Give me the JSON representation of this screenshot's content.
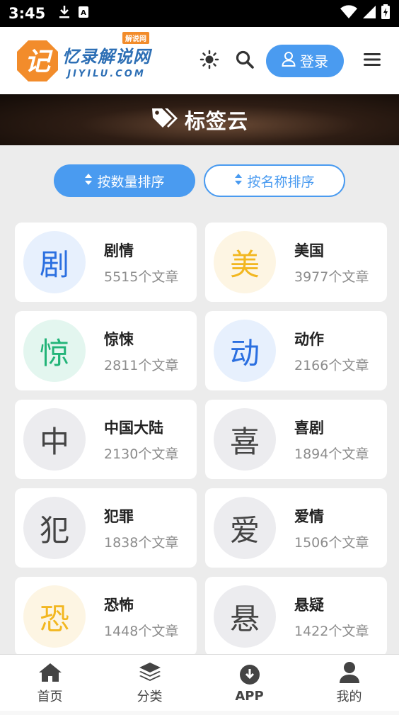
{
  "status_bar": {
    "time": "3:45",
    "icons": [
      "download-icon",
      "a-keyboard-icon",
      "wifi-icon",
      "signal-icon",
      "battery-icon"
    ]
  },
  "header": {
    "logo_mark": "记",
    "logo_cn": "忆录解说网",
    "logo_en": "JIYILU.COM",
    "logo_badge": "解说网",
    "login_label": "登录",
    "icons": [
      "sun-icon",
      "search-icon",
      "user-icon",
      "menu-icon"
    ]
  },
  "banner": {
    "title": "标签云",
    "icon": "tags-icon"
  },
  "sort": {
    "by_count": "按数量排序",
    "by_name": "按名称排序"
  },
  "tags": [
    {
      "char": "剧",
      "name": "剧情",
      "count": "5515个文章",
      "color": "blue"
    },
    {
      "char": "美",
      "name": "美国",
      "count": "3977个文章",
      "color": "yellow"
    },
    {
      "char": "惊",
      "name": "惊悚",
      "count": "2811个文章",
      "color": "green"
    },
    {
      "char": "动",
      "name": "动作",
      "count": "2166个文章",
      "color": "blue"
    },
    {
      "char": "中",
      "name": "中国大陆",
      "count": "2130个文章",
      "color": "gray"
    },
    {
      "char": "喜",
      "name": "喜剧",
      "count": "1894个文章",
      "color": "gray"
    },
    {
      "char": "犯",
      "name": "犯罪",
      "count": "1838个文章",
      "color": "gray"
    },
    {
      "char": "爱",
      "name": "爱情",
      "count": "1506个文章",
      "color": "gray"
    },
    {
      "char": "恐",
      "name": "恐怖",
      "count": "1448个文章",
      "color": "yellow"
    },
    {
      "char": "悬",
      "name": "悬疑",
      "count": "1422个文章",
      "color": "gray"
    }
  ],
  "bottom_nav": [
    {
      "label": "首页",
      "icon": "home-icon"
    },
    {
      "label": "分类",
      "icon": "layers-icon"
    },
    {
      "label": "APP",
      "icon": "download-circle-icon"
    },
    {
      "label": "我的",
      "icon": "user-icon"
    }
  ],
  "colors": {
    "accent": "#4a9bf0",
    "logo_orange": "#f28c2b",
    "logo_blue": "#2d6fb5"
  }
}
